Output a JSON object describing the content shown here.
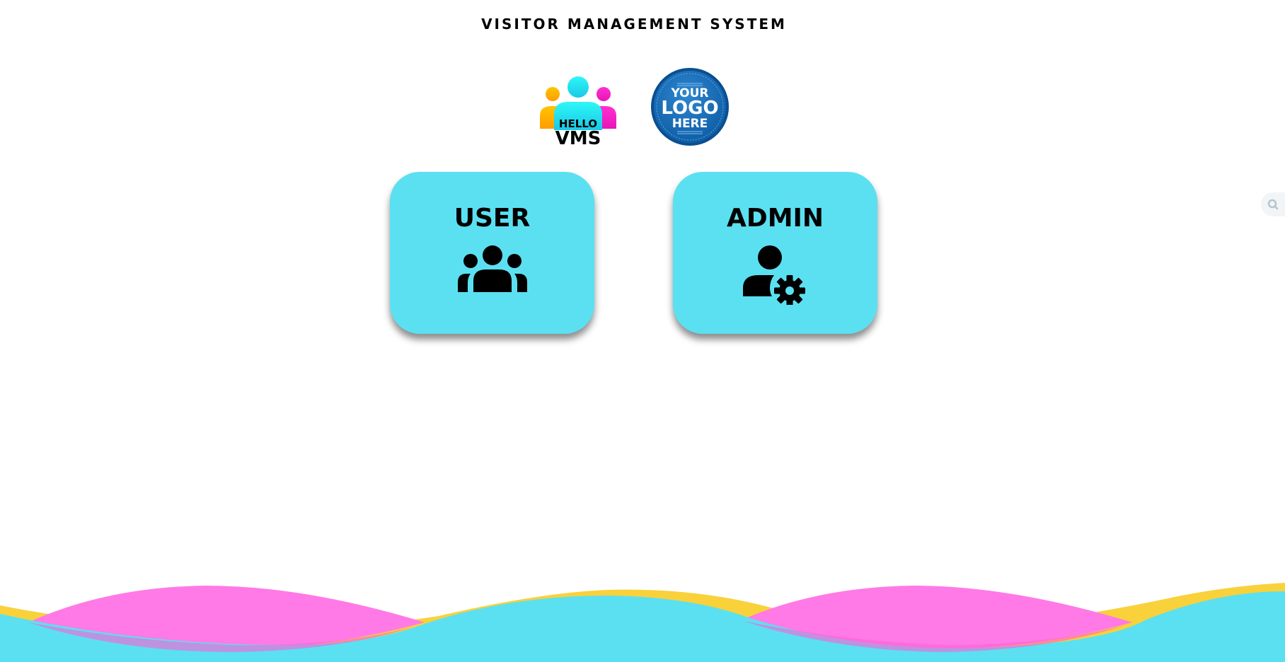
{
  "header": {
    "title": "VISITOR MANAGEMENT SYSTEM"
  },
  "logos": {
    "app_logo": {
      "text_top": "HELLO",
      "text_bottom": "VMS",
      "colors": [
        "#ffb300",
        "#29f5f5",
        "#ff1fc8"
      ]
    },
    "client_logo": {
      "line1": "YOUR",
      "line2": "LOGO",
      "line3": "HERE",
      "color": "#1267b3"
    }
  },
  "cards": {
    "user": {
      "label": "USER",
      "icon": "group-icon"
    },
    "admin": {
      "label": "ADMIN",
      "icon": "admin-settings-icon"
    }
  },
  "side_handle": {
    "icon": "search-icon"
  },
  "theme": {
    "card_color": "#5be0f1",
    "wave_cyan": "#5be0f1",
    "wave_pink": "#ff7ae6",
    "wave_yellow": "#f9d13b"
  }
}
